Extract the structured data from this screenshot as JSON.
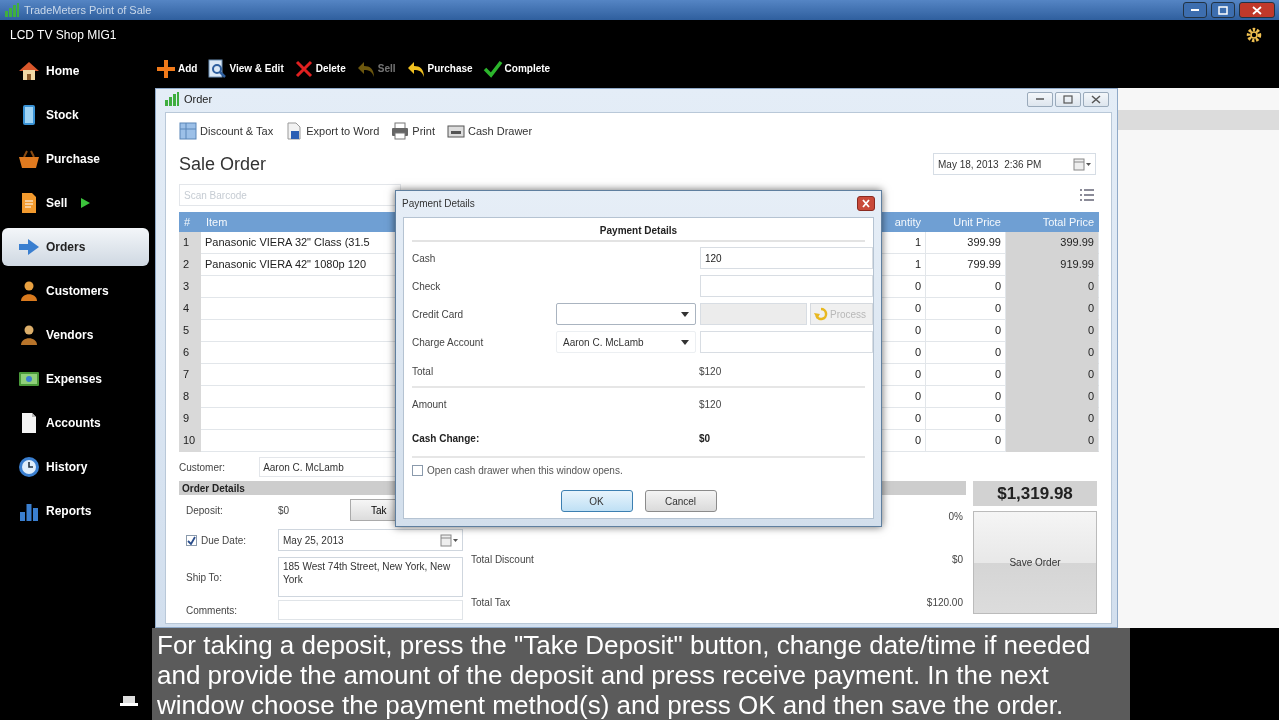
{
  "window": {
    "title": "TradeMeters Point of Sale"
  },
  "shop_name": "LCD TV Shop MIG1",
  "sidebar": {
    "items": [
      {
        "label": "Home",
        "selected": false,
        "submenu": false
      },
      {
        "label": "Stock",
        "selected": false,
        "submenu": false
      },
      {
        "label": "Purchase",
        "selected": false,
        "submenu": false
      },
      {
        "label": "Sell",
        "selected": false,
        "submenu": true
      },
      {
        "label": "Orders",
        "selected": true,
        "submenu": false
      },
      {
        "label": "Customers",
        "selected": false,
        "submenu": false
      },
      {
        "label": "Vendors",
        "selected": false,
        "submenu": false
      },
      {
        "label": "Expenses",
        "selected": false,
        "submenu": false
      },
      {
        "label": "Accounts",
        "selected": false,
        "submenu": false
      },
      {
        "label": "History",
        "selected": false,
        "submenu": false
      },
      {
        "label": "Reports",
        "selected": false,
        "submenu": false
      }
    ]
  },
  "toolbar": [
    {
      "label": "Add",
      "disabled": false
    },
    {
      "label": "View & Edit",
      "disabled": false
    },
    {
      "label": "Delete",
      "disabled": false
    },
    {
      "label": "Sell",
      "disabled": true
    },
    {
      "label": "Purchase",
      "disabled": false
    },
    {
      "label": "Complete",
      "disabled": false
    }
  ],
  "order_window": {
    "title": "Order",
    "toolbar": [
      "Discount & Tax",
      "Export to Word",
      "Print",
      "Cash Drawer"
    ],
    "heading": "Sale Order",
    "date": "May 18, 2013  2:36 PM",
    "barcode": {
      "placeholder": "Scan Barcode"
    },
    "table": {
      "columns": [
        "#",
        "Item",
        "antity",
        "Unit Price",
        "Total Price"
      ],
      "rows": [
        [
          "1",
          "Panasonic VIERA 32\" Class (31.5",
          "1",
          "399.99",
          "399.99"
        ],
        [
          "2",
          "Panasonic VIERA 42\" 1080p 120",
          "1",
          "799.99",
          "919.99"
        ],
        [
          "3",
          "",
          "0",
          "0",
          "0"
        ],
        [
          "4",
          "",
          "0",
          "0",
          "0"
        ],
        [
          "5",
          "",
          "0",
          "0",
          "0"
        ],
        [
          "6",
          "",
          "0",
          "0",
          "0"
        ],
        [
          "7",
          "",
          "0",
          "0",
          "0"
        ],
        [
          "8",
          "",
          "0",
          "0",
          "0"
        ],
        [
          "9",
          "",
          "0",
          "0",
          "0"
        ],
        [
          "10",
          "",
          "0",
          "0",
          "0"
        ]
      ]
    },
    "customer": {
      "label": "Customer:",
      "value": "Aaron C. McLamb"
    },
    "order_details": {
      "title": "Order Details",
      "deposit": {
        "label": "Deposit:",
        "value": "$0",
        "button": "Tak"
      },
      "due_date": {
        "label": "Due Date:",
        "checked": true,
        "value": "May 25, 2013"
      },
      "ship_to": {
        "label": "Ship To:",
        "value": "185 West 74th Street, New York, New York"
      },
      "comments": {
        "label": "Comments:"
      }
    },
    "totals": [
      {
        "value": "0%"
      },
      {
        "label": "Total Discount",
        "value": "$0"
      },
      {
        "label": "Total Tax",
        "value": "$120.00"
      }
    ],
    "grand_total": "$1,319.98",
    "save_button": "Save Order"
  },
  "payment_dialog": {
    "title": "Payment Details",
    "heading": "Payment Details",
    "rows": [
      {
        "kind": "input",
        "label": "Cash",
        "value": "120"
      },
      {
        "kind": "input",
        "label": "Check"
      },
      {
        "kind": "card",
        "label": "Credit Card",
        "button": "Process"
      },
      {
        "kind": "account",
        "label": "Charge Account",
        "value": "Aaron C. McLamb"
      }
    ],
    "summary": [
      {
        "label": "Total",
        "value": "$120",
        "bold": false
      },
      {
        "label": "Amount",
        "value": "$120",
        "bold": false
      },
      {
        "label": "Cash Change:",
        "value": "$0",
        "bold": true
      }
    ],
    "open_drawer": {
      "label": "Open cash drawer when this window opens.",
      "checked": false
    },
    "buttons": [
      {
        "label": "OK",
        "default": true
      },
      {
        "label": "Cancel",
        "default": false
      }
    ]
  },
  "caption": "For taking a deposit, press the \"Take Deposit\" button, change date/time if needed and provide the amount of the deposit and press receive payment. In the next window choose the payment method(s) and press OK and then save the order."
}
